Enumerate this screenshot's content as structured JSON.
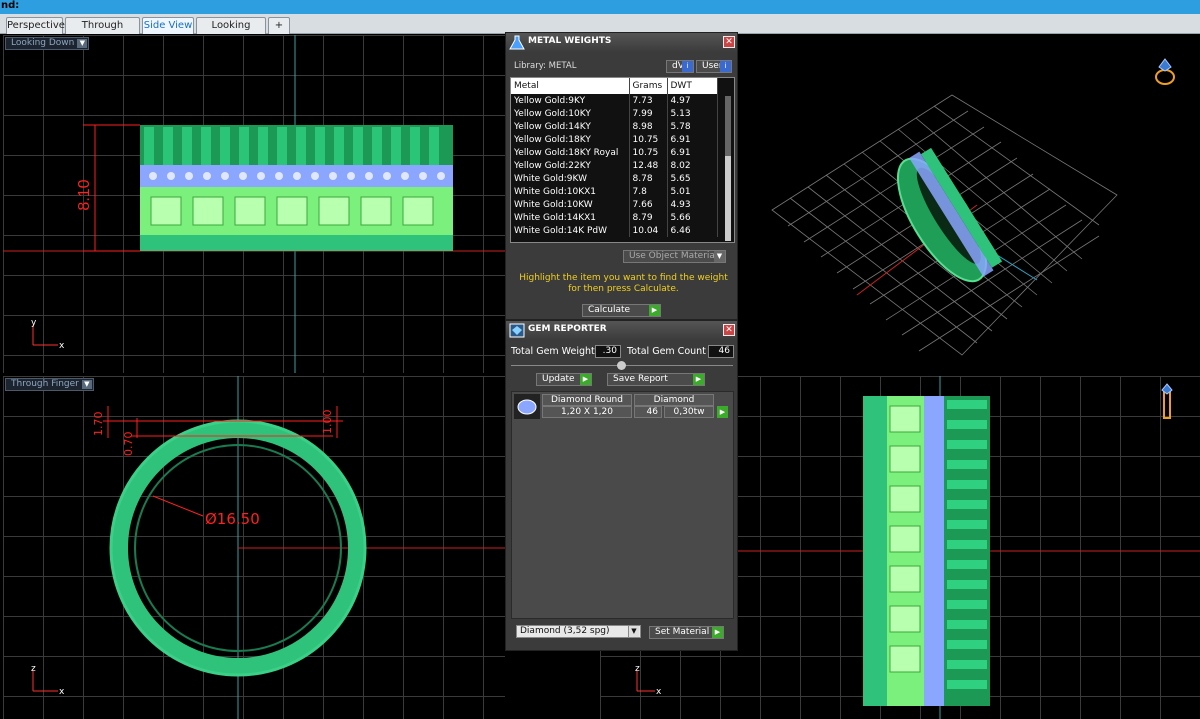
{
  "window": {
    "title": "nd:"
  },
  "tabs": [
    {
      "label": "Perspective",
      "active": false
    },
    {
      "label": "Through Finger",
      "active": false
    },
    {
      "label": "Side View",
      "active": true
    },
    {
      "label": "Looking Down",
      "active": false
    },
    {
      "label": "+",
      "active": false
    }
  ],
  "viewports": {
    "top_left": {
      "label": "Looking Down",
      "dimension": "8.10",
      "axes": [
        "y",
        "x"
      ]
    },
    "bottom_left": {
      "label": "Through Finger",
      "dims": [
        "1.70",
        "0.70",
        "1.00"
      ],
      "diameter": "Ø16.50",
      "axes": [
        "z",
        "x"
      ]
    },
    "bottom_right": {
      "axes": [
        "z",
        "x"
      ]
    }
  },
  "metal_weights": {
    "title": "METAL WEIGHTS",
    "library_label": "Library: METAL",
    "toggle_left": "dV",
    "toggle_right": "User",
    "columns": [
      "Metal",
      "Grams",
      "DWT"
    ],
    "rows": [
      [
        "Yellow Gold:9KY",
        "7.73",
        "4.97"
      ],
      [
        "Yellow Gold:10KY",
        "7.99",
        "5.13"
      ],
      [
        "Yellow Gold:14KY",
        "8.98",
        "5.78"
      ],
      [
        "Yellow Gold:18KY",
        "10.75",
        "6.91"
      ],
      [
        "Yellow Gold:18KY Royal",
        "10.75",
        "6.91"
      ],
      [
        "Yellow Gold:22KY",
        "12.48",
        "8.02"
      ],
      [
        "White Gold:9KW",
        "8.78",
        "5.65"
      ],
      [
        "White Gold:10KX1",
        "7.8",
        "5.01"
      ],
      [
        "White Gold:10KW",
        "7.66",
        "4.93"
      ],
      [
        "White Gold:14KX1",
        "8.79",
        "5.66"
      ],
      [
        "White Gold:14K PdW",
        "10.04",
        "6.46"
      ]
    ],
    "use_object_materials": "Use Object Materials",
    "hint": "Highlight the item you want to find the weight for then press Calculate.",
    "calculate_label": "Calculate"
  },
  "gem_reporter": {
    "title": "GEM REPORTER",
    "total_weight_label": "Total Gem Weight",
    "total_weight_value": ".30",
    "total_count_label": "Total Gem Count",
    "total_count_value": "46",
    "update_label": "Update",
    "save_report_label": "Save Report",
    "row": {
      "shape": "Diamond Round",
      "material": "Diamond",
      "size": "1,20 X 1,20",
      "count": "46",
      "weight": "0,30tw"
    },
    "material_select": "Diamond     (3,52 spg)",
    "set_material_label": "Set Material"
  },
  "colors": {
    "accent": "#2d9fe0",
    "ring_green": "#2fc27a",
    "ring_light": "#7cf07c",
    "gem_blue": "#8aa6ff",
    "dim_red": "#ff2020"
  }
}
